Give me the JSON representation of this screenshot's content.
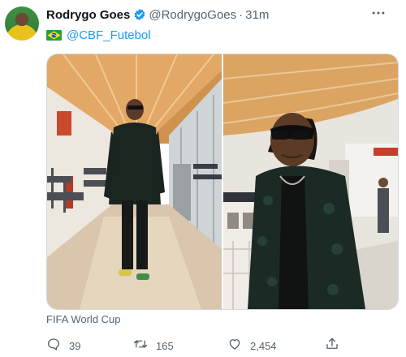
{
  "tweet": {
    "author_name": "Rodrygo Goes",
    "handle": "@RodrygoGoes",
    "time": "31m",
    "separator": "·",
    "mention": "@CBF_Futebol",
    "media_caption": "FIFA World Cup",
    "icons": {
      "verified": "verified-badge-icon",
      "flag": "brazil-flag-icon",
      "more": "more-icon"
    }
  },
  "actions": {
    "replies": "39",
    "retweets": "165",
    "likes": "2,454",
    "reply_icon": "reply-icon",
    "retweet_icon": "retweet-icon",
    "like_icon": "heart-icon",
    "share_icon": "share-icon"
  },
  "colors": {
    "text_primary": "#0f1419",
    "text_secondary": "#536471",
    "link": "#1d9bf0",
    "verified": "#1d9bf0",
    "border": "#cfd9de"
  }
}
